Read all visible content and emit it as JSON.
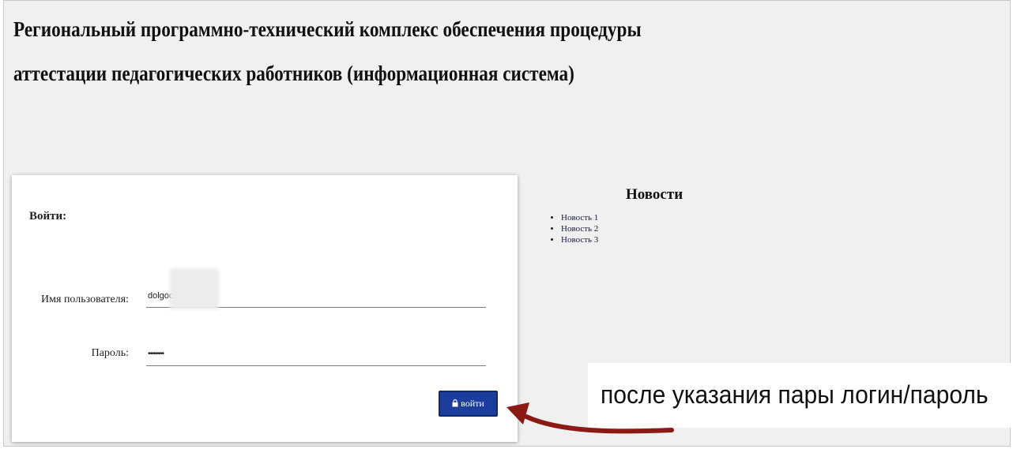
{
  "header": {
    "title_line1": "Региональный программно-технический комплекс обеспечения процедуры",
    "title_line2": "аттестации педагогических работников (информационная система)"
  },
  "login": {
    "heading": "Войти:",
    "username_label": "Имя пользователя:",
    "username_value": "dolgoc",
    "password_label": "Пароль:",
    "password_value": "••••••••",
    "button_label": "войти",
    "button_icon": "lock-icon"
  },
  "news": {
    "title": "Новости",
    "items": [
      "Новость 1",
      "Новость 2",
      "Новость 3"
    ]
  },
  "annotation": {
    "text": "после указания пары логин/пароль",
    "arrow_color": "#8b1a14"
  },
  "colors": {
    "page_background": "#f0f0f0",
    "button_background": "#1a3d9e"
  }
}
